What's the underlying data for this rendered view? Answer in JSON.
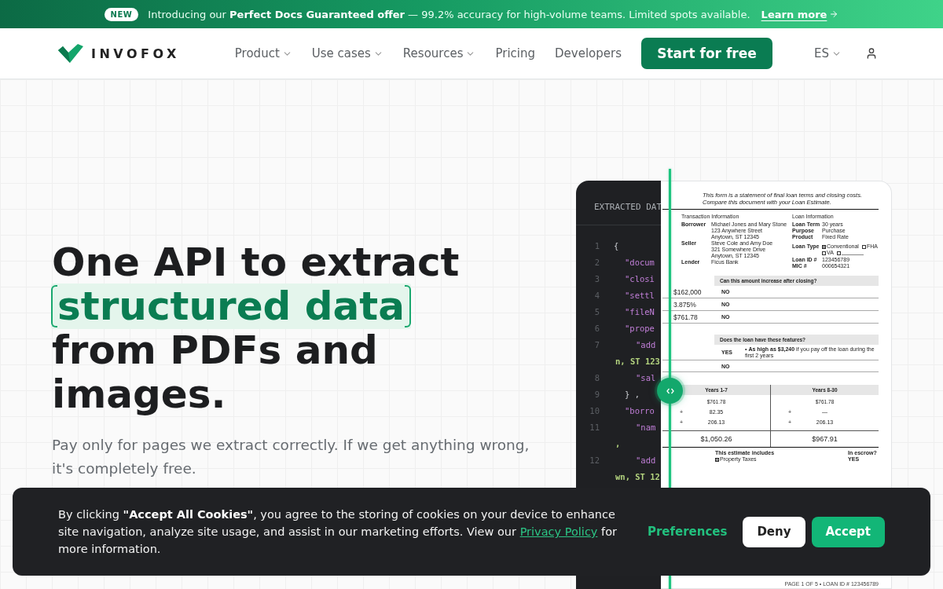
{
  "banner": {
    "badge": "NEW",
    "text": "Introducing our **Perfect Docs Guaranteed offer** — 99.2% accuracy for high-volume teams. Limited spots available.",
    "link": "Learn more"
  },
  "nav": {
    "logo": "INVOFOX",
    "items": [
      {
        "label": "Product",
        "dropdown": true
      },
      {
        "label": "Use cases",
        "dropdown": true
      },
      {
        "label": "Resources",
        "dropdown": true
      },
      {
        "label": "Pricing",
        "dropdown": false
      },
      {
        "label": "Developers",
        "dropdown": false
      }
    ],
    "cta": "Start for free",
    "language": "ES"
  },
  "hero": {
    "heading_lines": [
      {
        "text": "One API to extract",
        "highlighted": false
      },
      {
        "text": "structured data",
        "highlighted": true
      },
      {
        "text": "from PDFs and",
        "highlighted": false
      },
      {
        "text": "images.",
        "highlighted": false
      }
    ],
    "subtitle": "Pay only for pages we extract correctly. If we get anything wrong, it's completely free."
  },
  "code_panel": {
    "title": "EXTRACTED DAT",
    "lines": [
      {
        "number": "1",
        "kind": "punct",
        "text": "{",
        "children": [
          {
            "number": "2",
            "kind": "key",
            "text": "\"docum"
          },
          {
            "number": "3",
            "kind": "key",
            "text": "\"closi"
          },
          {
            "number": "4",
            "kind": "key",
            "text": "\"settl"
          },
          {
            "number": "5",
            "kind": "key",
            "text": "\"fileN"
          },
          {
            "number": "6",
            "kind": "key",
            "text": "\"prope",
            "children": [
              {
                "number": "7",
                "kind": "key",
                "text": "\"add",
                "continuation": "n, ST 123"
              },
              {
                "number": "8",
                "kind": "key",
                "text": "\"sal"
              }
            ]
          },
          {
            "number": "9",
            "kind": "punct",
            "text": "} ,"
          },
          {
            "number": "10",
            "kind": "key",
            "text": "\"borro",
            "children": [
              {
                "number": "11",
                "kind": "key",
                "text": "\"nam",
                "continuation": ","
              },
              {
                "number": "12",
                "kind": "key",
                "text": "\"add",
                "continuation": "wn, ST 12"
              }
            ]
          }
        ]
      }
    ]
  },
  "document": {
    "intro": "This form is a statement of final loan terms and closing costs. Compare this document with your Loan Estimate.",
    "transaction": {
      "heading": "Transaction Information",
      "rows": [
        {
          "label": "Borrower",
          "lines": [
            "Michael Jones and Mary Stone",
            "123 Anywhere Street",
            "Anytown, ST 12345"
          ]
        },
        {
          "label": "Seller",
          "lines": [
            "Steve Cole and Amy Doe",
            "321 Somewhere Drive",
            "Anytown, ST 12345"
          ]
        },
        {
          "label": "Lender",
          "lines": [
            "Ficus Bank"
          ]
        }
      ]
    },
    "loan": {
      "heading": "Loan Information",
      "rows": [
        {
          "kind": "text",
          "label": "Loan Term",
          "value": "30 years"
        },
        {
          "kind": "text",
          "label": "Purpose",
          "value": "Purchase"
        },
        {
          "kind": "text",
          "label": "Product",
          "value": "Fixed Rate"
        },
        {
          "kind": "options",
          "label": "Loan Type",
          "options": [
            {
              "label": "Conventional",
              "checked": true
            },
            {
              "label": "FHA",
              "checked": false
            },
            {
              "label": "VA",
              "checked": false
            },
            {
              "checked": false
            }
          ]
        },
        {
          "kind": "text",
          "label": "Loan ID #",
          "value": "123456789"
        },
        {
          "kind": "text",
          "label": "MIC #",
          "value": "000654321"
        }
      ]
    },
    "increase": {
      "heading": "Can this amount increase after closing?",
      "rows": [
        {
          "amount": "$162,000",
          "answer": "NO"
        },
        {
          "amount": "3.875%",
          "answer": "NO"
        },
        {
          "amount": "$761.78",
          "answer": "NO"
        }
      ]
    },
    "features": {
      "heading": "Does the loan have these features?",
      "rows": [
        {
          "answer": "YES",
          "detail": "• **As high as $3,240** if you pay off the loan during the first 2 years"
        },
        {
          "answer": "NO"
        }
      ]
    },
    "payments": {
      "columns": [
        {
          "heading": "Years 1-7",
          "principal": "$761.78",
          "items": [
            {
              "sign": "+",
              "amount": "82.35"
            },
            {
              "sign": "+",
              "amount": "206.13"
            }
          ],
          "total": "$1,050.26"
        },
        {
          "heading": "Years 8-30",
          "principal": "$761.78",
          "items": [
            {
              "sign": "+",
              "amount": "—"
            },
            {
              "sign": "+",
              "amount": "206.13"
            }
          ],
          "total": "$967.91"
        }
      ]
    },
    "escrow": {
      "includes_heading": "This estimate includes",
      "includes": [
        {
          "label": "Property Taxes",
          "checked": true
        }
      ],
      "escrow_heading": "In escrow?",
      "escrow_values": [
        "YES"
      ]
    },
    "footer": "PAGE 1 OF 5 • LOAN ID # 123456789"
  },
  "cookie_banner": {
    "text_before": "By clicking **\"Accept All Cookies\"**, you agree to the storing of cookies on your device to enhance site navigation, analyze site usage, and assist in our marketing efforts. View our",
    "link": "Privacy Policy",
    "text_after": "for more information.",
    "buttons": [
      {
        "kind": "text",
        "label": "Preferences"
      },
      {
        "kind": "secondary",
        "label": "Deny"
      },
      {
        "kind": "primary",
        "label": "Accept"
      }
    ]
  }
}
